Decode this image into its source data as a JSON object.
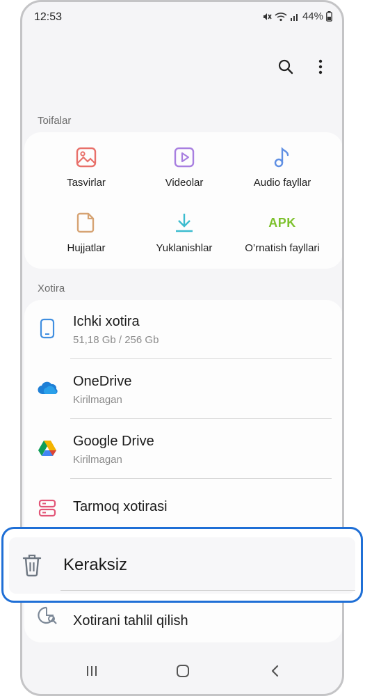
{
  "status": {
    "time": "12:53",
    "battery": "44%"
  },
  "toolbar": {
    "search_icon": "search-icon",
    "more_icon": "more-vertical-icon"
  },
  "categories": {
    "title": "Toifalar",
    "items": [
      {
        "label": "Tasvirlar",
        "icon": "image-icon",
        "color": "#e8706a"
      },
      {
        "label": "Videolar",
        "icon": "video-icon",
        "color": "#a87fe0"
      },
      {
        "label": "Audio fayllar",
        "icon": "audio-icon",
        "color": "#5f8fe3"
      },
      {
        "label": "Hujjatlar",
        "icon": "document-icon",
        "color": "#d6a373"
      },
      {
        "label": "Yuklanishlar",
        "icon": "download-icon",
        "color": "#3cbccf"
      },
      {
        "label": "O’rnatish fayllari",
        "icon": "apk-icon",
        "text": "APK",
        "color": "#7dc12d"
      }
    ]
  },
  "storage": {
    "title": "Xotira",
    "items": [
      {
        "title": "Ichki xotira",
        "sub": "51,18 Gb / 256 Gb",
        "icon": "phone-icon"
      },
      {
        "title": "OneDrive",
        "sub": "Kirilmagan",
        "icon": "onedrive-icon"
      },
      {
        "title": "Google Drive",
        "sub": "Kirilmagan",
        "icon": "google-drive-icon"
      },
      {
        "title": "Tarmoq xotirasi",
        "sub": "",
        "icon": "network-storage-icon"
      },
      {
        "title": "Xotirani tahlil qilish",
        "sub": "",
        "icon": "storage-analysis-icon"
      }
    ]
  },
  "highlight": {
    "label": "Keraksiz",
    "icon": "trash-icon",
    "color": "#1f6fd6"
  },
  "nav": {
    "recents": "recents-icon",
    "home": "home-icon",
    "back": "back-icon"
  }
}
